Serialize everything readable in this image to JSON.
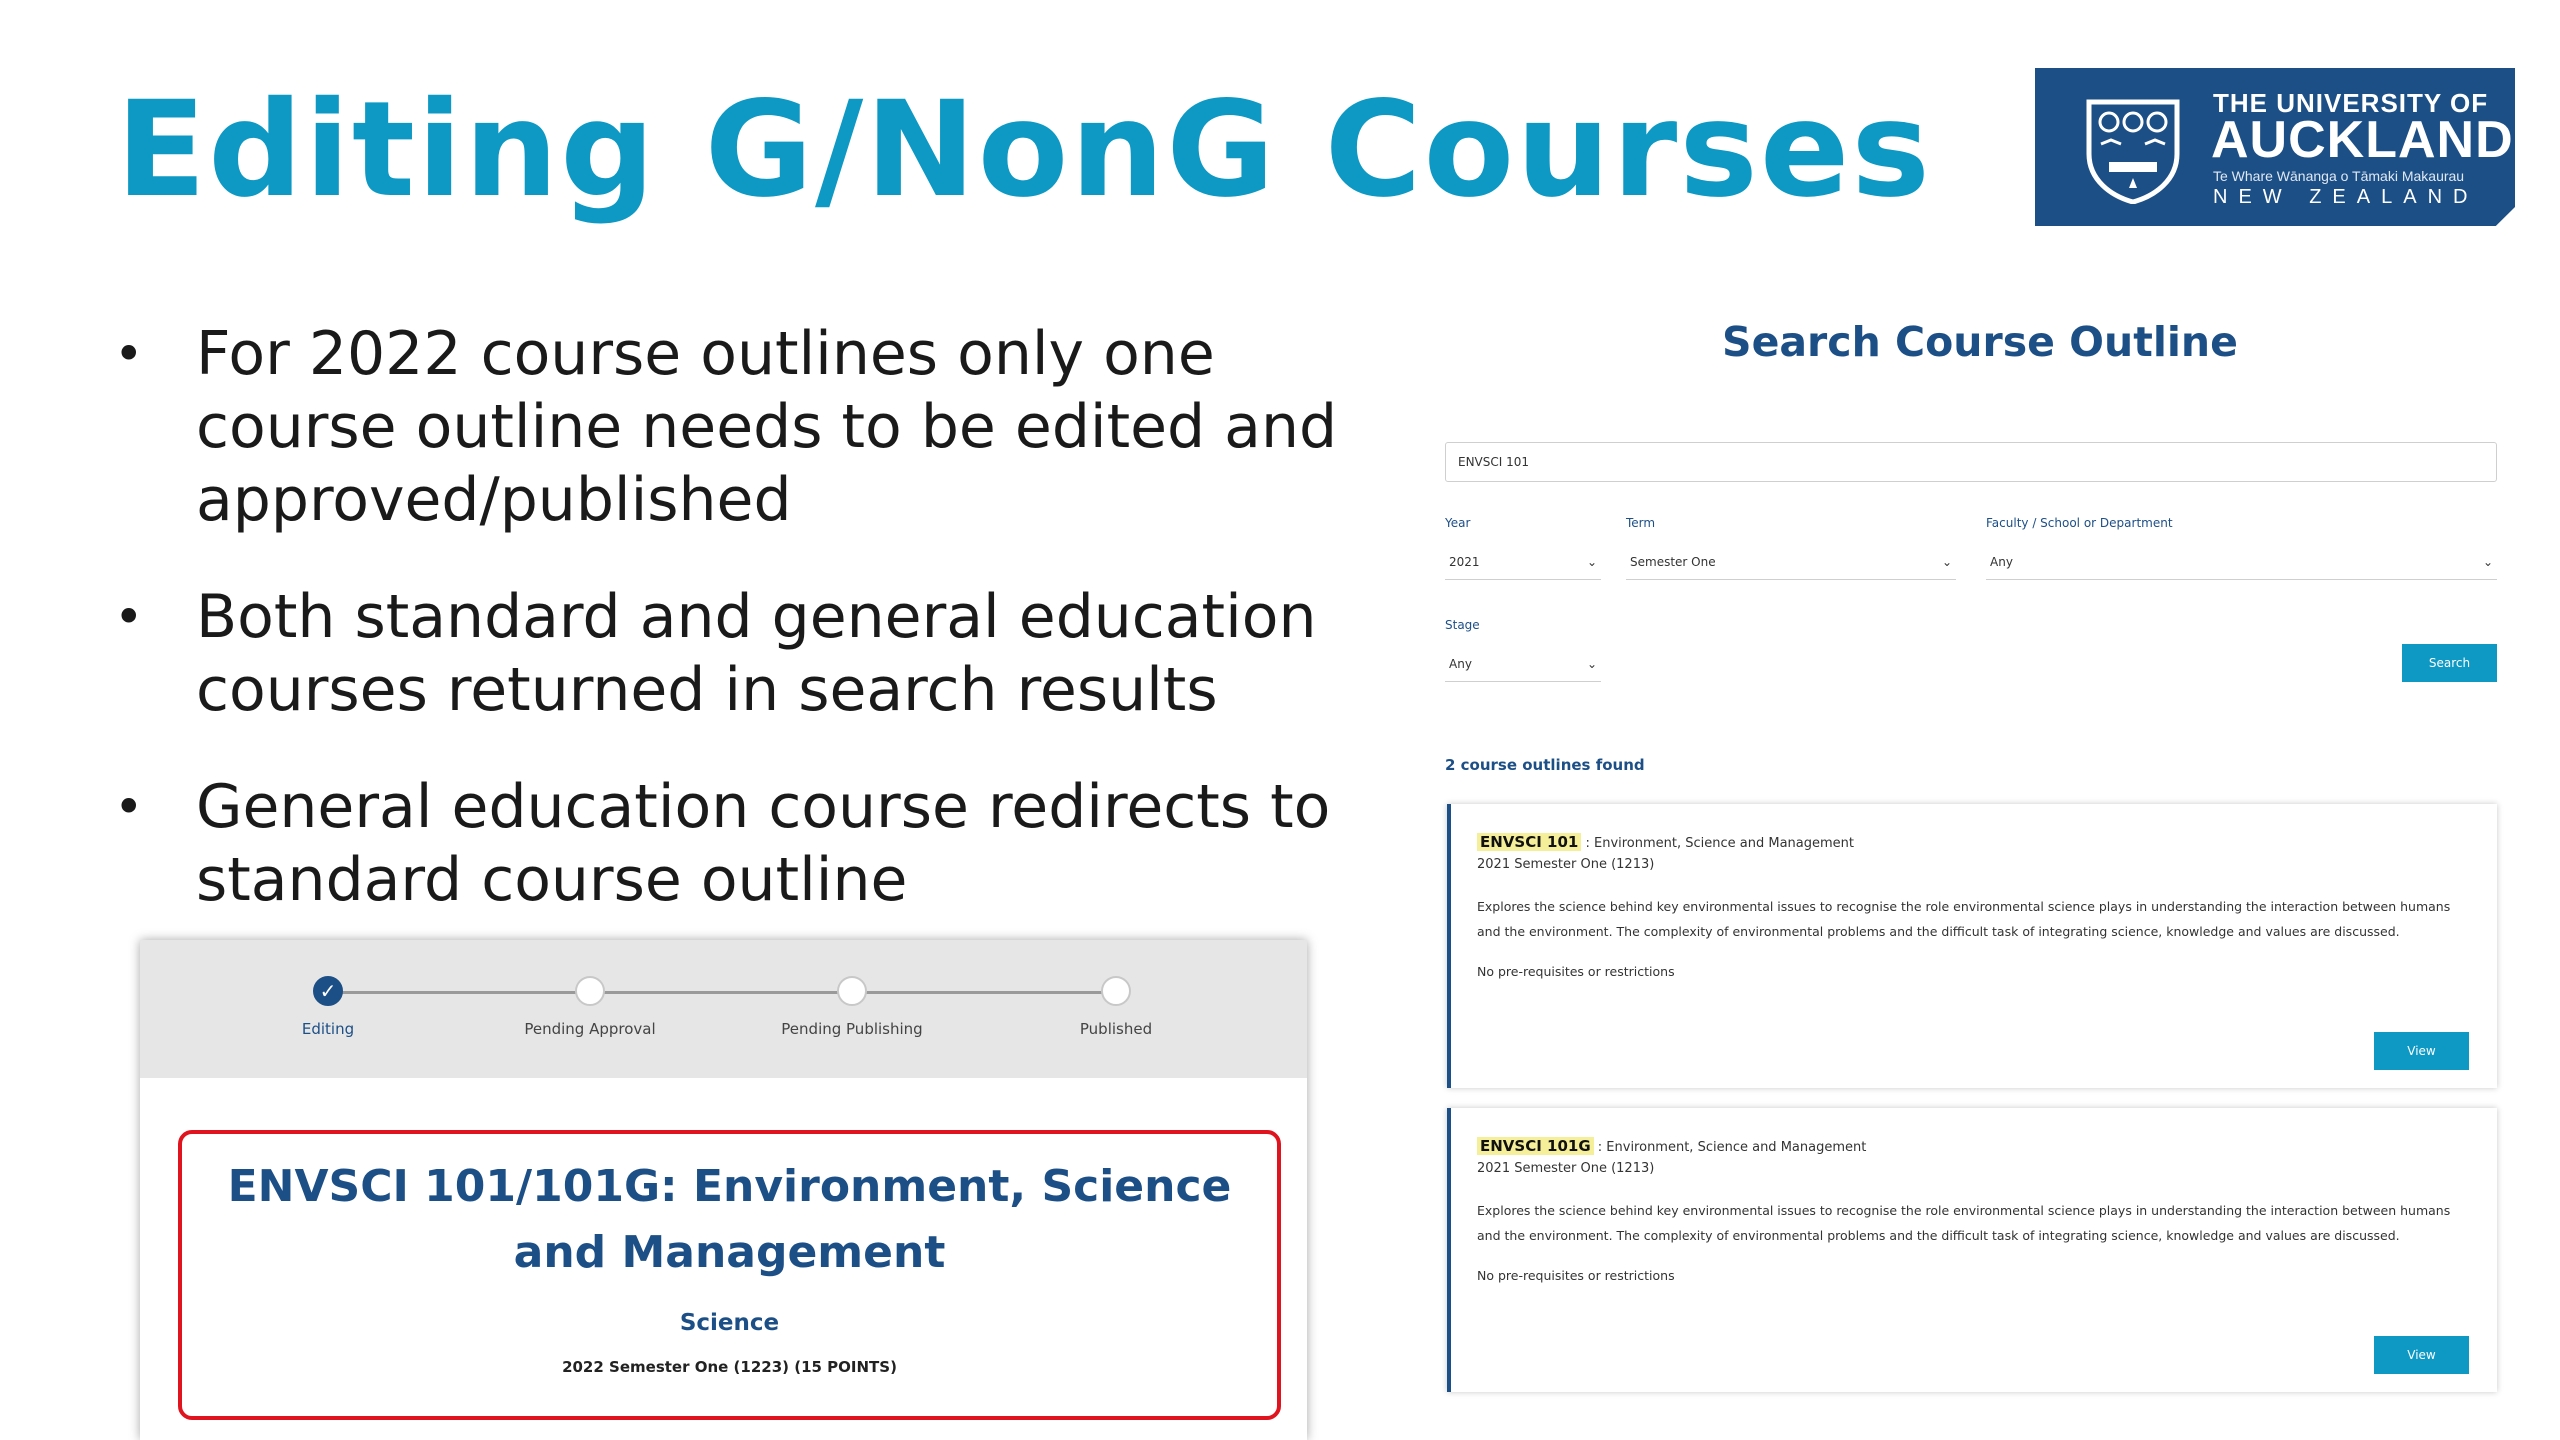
{
  "slide": {
    "title": "Editing G/NonG Courses",
    "bullets": [
      "For 2022 course outlines only one course outline needs to be edited and approved/published",
      "Both standard and general education courses returned in search results",
      "General education course redirects to standard course outline"
    ]
  },
  "logo": {
    "line1": "THE UNIVERSITY OF",
    "line2": "AUCKLAND",
    "line3": "Te Whare Wānanga o Tāmaki Makaurau",
    "line4": "NEW ZEALAND",
    "color": "#1d4f87"
  },
  "workflow": {
    "steps": [
      {
        "label": "Editing",
        "state": "done",
        "icon": "check-icon"
      },
      {
        "label": "Pending Approval",
        "state": "pending"
      },
      {
        "label": "Pending Publishing",
        "state": "pending"
      },
      {
        "label": "Published",
        "state": "pending"
      }
    ],
    "course_title": "ENVSCI 101/101G: Environment, Science and Management",
    "faculty": "Science",
    "meta": "2022 Semester One (1223) (15 POINTS)"
  },
  "search": {
    "title": "Search Course Outline",
    "query": "ENVSCI 101",
    "year_label": "Year",
    "year_value": "2021",
    "term_label": "Term",
    "term_value": "Semester One",
    "faculty_label": "Faculty / School or Department",
    "faculty_value": "Any",
    "stage_label": "Stage",
    "stage_value": "Any",
    "search_button": "Search",
    "results_count": "2 course outlines found",
    "results": [
      {
        "code": "ENVSCI 101",
        "name": " : Environment, Science and Management",
        "semester": "2021 Semester One (1213)",
        "description": "Explores the science behind key environmental issues to recognise the role environmental science plays in understanding the interaction between humans and the environment. The complexity of environmental problems and the difficult task of integrating science, knowledge and values are discussed.",
        "prereq": "No pre-requisites or restrictions",
        "view_button": "View"
      },
      {
        "code": "ENVSCI 101G",
        "name": " : Environment, Science and Management",
        "semester": "2021 Semester One (1213)",
        "description": "Explores the science behind key environmental issues to recognise the role environmental science plays in understanding the interaction between humans and the environment. The complexity of environmental problems and the difficult task of integrating science, knowledge and values are discussed.",
        "prereq": "No pre-requisites or restrictions",
        "view_button": "View"
      }
    ]
  },
  "colors": {
    "title": "#0d99c4",
    "brand_navy": "#1d4f87",
    "accent_button": "#0d99c4",
    "highlight_border": "#e0141e",
    "code_highlight": "#f6ef9a"
  }
}
